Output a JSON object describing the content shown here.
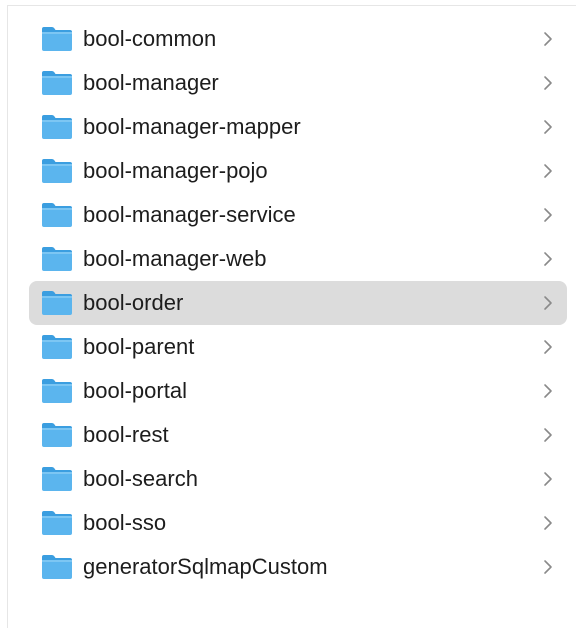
{
  "colors": {
    "selected_row": "#dcdcdc",
    "folder_body": "#5bb5ee",
    "folder_tab": "#3b9ee0",
    "chevron": "#8a8a8a"
  },
  "items": [
    {
      "label": "bool-common",
      "icon": "folder-icon",
      "selected": false
    },
    {
      "label": "bool-manager",
      "icon": "folder-icon",
      "selected": false
    },
    {
      "label": "bool-manager-mapper",
      "icon": "folder-icon",
      "selected": false
    },
    {
      "label": "bool-manager-pojo",
      "icon": "folder-icon",
      "selected": false
    },
    {
      "label": "bool-manager-service",
      "icon": "folder-icon",
      "selected": false
    },
    {
      "label": "bool-manager-web",
      "icon": "folder-icon",
      "selected": false
    },
    {
      "label": "bool-order",
      "icon": "folder-icon",
      "selected": true
    },
    {
      "label": "bool-parent",
      "icon": "folder-icon",
      "selected": false
    },
    {
      "label": "bool-portal",
      "icon": "folder-icon",
      "selected": false
    },
    {
      "label": "bool-rest",
      "icon": "folder-icon",
      "selected": false
    },
    {
      "label": "bool-search",
      "icon": "folder-icon",
      "selected": false
    },
    {
      "label": "bool-sso",
      "icon": "folder-icon",
      "selected": false
    },
    {
      "label": "generatorSqlmapCustom",
      "icon": "folder-icon",
      "selected": false
    }
  ]
}
